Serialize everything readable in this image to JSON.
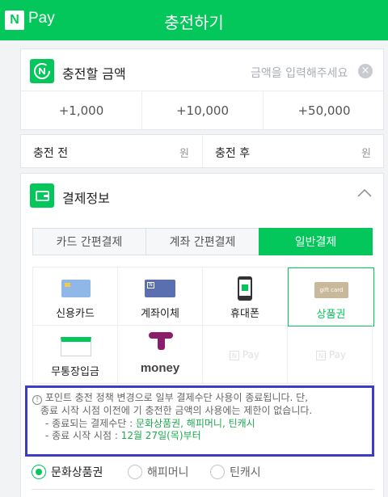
{
  "header": {
    "logo_letter": "N",
    "logo_text": "Pay",
    "title": "충전하기"
  },
  "charge_amount": {
    "label": "충전할 금액",
    "placeholder": "금액을 입력해주세요",
    "quick_amounts": [
      "+1,000",
      "+10,000",
      "+50,000"
    ]
  },
  "balance": {
    "before_label": "충전 전",
    "after_label": "충전 후",
    "unit": "원"
  },
  "payment": {
    "title": "결제정보",
    "tabs": [
      "카드 간편결제",
      "계좌 간편결제",
      "일반결제"
    ],
    "active_tab": 2,
    "methods": [
      "신용카드",
      "계좌이체",
      "휴대폰",
      "상품권",
      "무통장입금",
      "money"
    ],
    "selected_method": "상품권",
    "disabled_pay_text": "Pay"
  },
  "notice": {
    "line1": "포인트 충전 정책 변경으로 일부 결제수단 사용이 종료됩니다. 단,",
    "line2": "종료 시작 시점 이전에 기 충전한 금액의 사용에는 제한이 없습니다.",
    "line3_prefix": "- 종료되는 결제수단 : ",
    "line3_value": "문화상품권, 해피머니, 틴캐시",
    "line4_prefix": "- 종료 시작 시점 : ",
    "line4_value": "12월 27일(목)부터"
  },
  "gift_cards": [
    "문화상품권",
    "해피머니",
    "틴캐시"
  ],
  "colors": {
    "brand": "#03c75a",
    "notice_border": "#3c3cc4",
    "notice_highlight": "#1fa84f"
  }
}
